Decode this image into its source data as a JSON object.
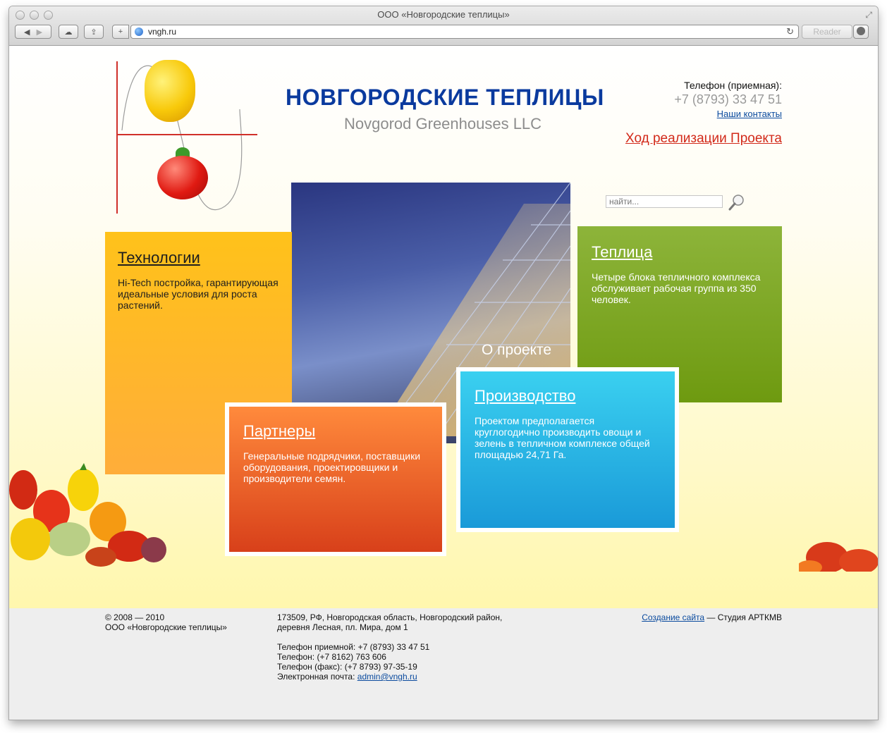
{
  "browser": {
    "window_title": "ООО «Новгородские теплицы»",
    "url": "vngh.ru",
    "reader_label": "Reader"
  },
  "header": {
    "title": "НОВГОРОДСКИЕ ТЕПЛИЦЫ",
    "subtitle": "Novgorod Greenhouses LLC",
    "phone_label": "Телефон (приемная):",
    "phone": "+7 (8793) 33 47 51",
    "contacts_link": "Наши контакты",
    "project_link": "Ход реализации Проекта"
  },
  "search": {
    "placeholder": "найти..."
  },
  "photo": {
    "caption": "О проекте"
  },
  "tiles": {
    "tech": {
      "title": "Технологии",
      "text": "Hi-Tech постройка, гарантирующая идеальные условия для роста растений."
    },
    "greenhouse": {
      "title": "Теплица",
      "text": "Четыре блока тепличного комплекса обслуживает рабочая группа из 350 человек."
    },
    "partners": {
      "title": "Партнеры",
      "text": "Генеральные подрядчики, поставщики оборудования, проектировщики и производители семян."
    },
    "production": {
      "title": "Производство",
      "text": "Проектом предполагается круглогодично производить овощи и зелень в тепличном комплексе общей площадью 24,71 Га."
    }
  },
  "footer": {
    "copyright": "© 2008 — 2010",
    "company": "ООО «Новгородские теплицы»",
    "address_line1": "173509, РФ, Новгородская область, Новгородский район,",
    "address_line2": "деревня Лесная, пл. Мира, дом 1",
    "phone_reception": "Телефон приемной: +7 (8793) 33 47 51",
    "phone": "Телефон: (+7 8162) 763 606",
    "fax": "Телефон (факс): (+7 8793) 97-35-19",
    "email_label": "Электронная почта: ",
    "email": "admin@vngh.ru",
    "site_link": "Создание сайта",
    "studio": " — Студия АРТКМВ"
  }
}
